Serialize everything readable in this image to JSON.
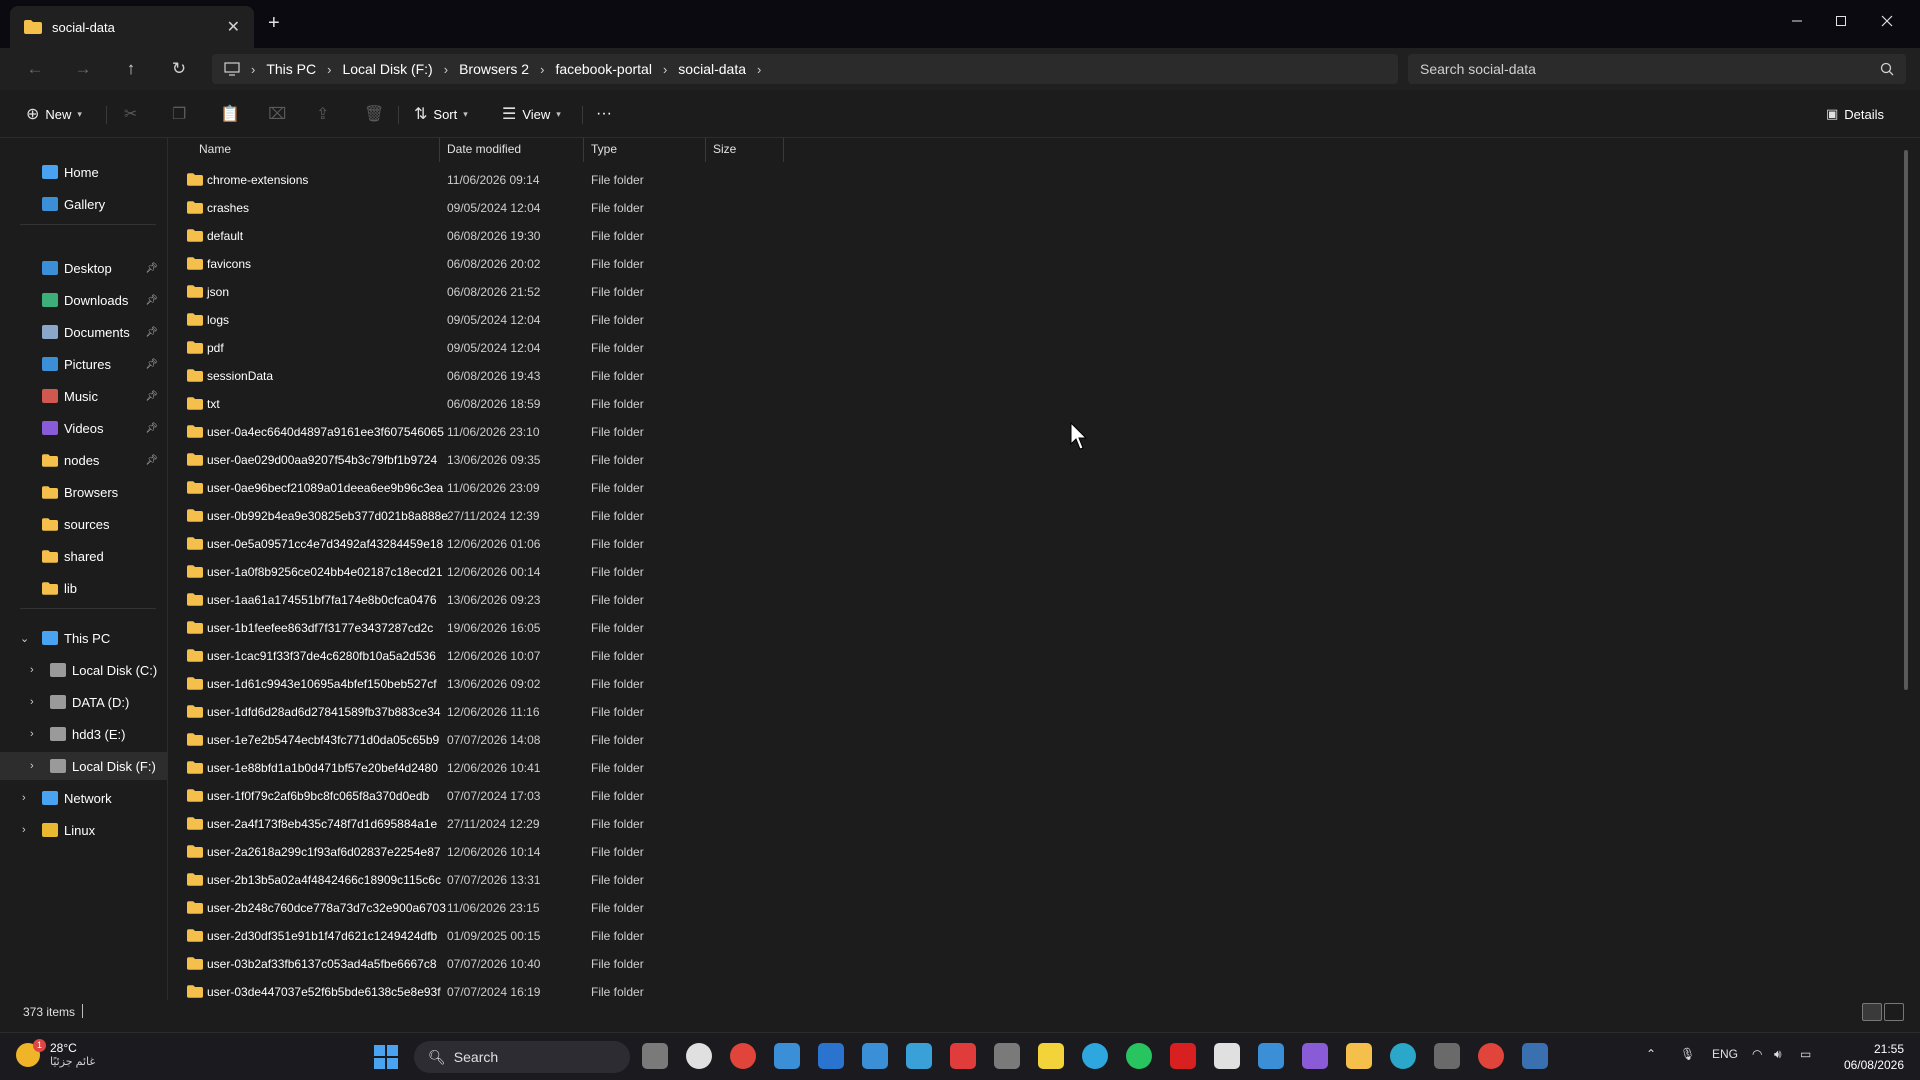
{
  "window": {
    "tab_title": "social-data",
    "new_tab": "+",
    "close_tab": "✕"
  },
  "address": {
    "breadcrumbs": [
      "This PC",
      "Local Disk (F:)",
      "Browsers 2",
      "facebook-portal",
      "social-data"
    ],
    "search_placeholder": "Search social-data"
  },
  "toolbar": {
    "new_label": "New",
    "sort_label": "Sort",
    "view_label": "View",
    "more_label": "···",
    "details_label": "Details"
  },
  "sidebar": {
    "top": [
      {
        "label": "Home",
        "icon": "home-icon"
      },
      {
        "label": "Gallery",
        "icon": "gallery-icon"
      }
    ],
    "quick": [
      {
        "label": "Desktop",
        "icon": "desktop-icon",
        "color": "#3a8fd6"
      },
      {
        "label": "Downloads",
        "icon": "download-icon",
        "color": "#3db07a"
      },
      {
        "label": "Documents",
        "icon": "document-icon",
        "color": "#8aa7c9"
      },
      {
        "label": "Pictures",
        "icon": "pictures-icon",
        "color": "#3a8fd6"
      },
      {
        "label": "Music",
        "icon": "music-icon",
        "color": "#d0584f"
      },
      {
        "label": "Videos",
        "icon": "videos-icon",
        "color": "#8a5bd6"
      },
      {
        "label": "nodes",
        "icon": "folder-icon",
        "color": "#f4c04b"
      }
    ],
    "folders": [
      {
        "label": "Browsers",
        "icon": "folder-icon"
      },
      {
        "label": "sources",
        "icon": "folder-icon"
      },
      {
        "label": "shared",
        "icon": "folder-icon"
      },
      {
        "label": "lib",
        "icon": "folder-icon"
      }
    ],
    "this_pc": "This PC",
    "drives": [
      "Local Disk (C:)",
      "DATA (D:)",
      "hdd3 (E:)",
      "Local Disk (F:)"
    ],
    "network": "Network",
    "linux": "Linux"
  },
  "columns": [
    "Name",
    "Date modified",
    "Type",
    "Size"
  ],
  "files": [
    {
      "name": "chrome-extensions",
      "date": "11/06/2026 09:14",
      "type": "File folder"
    },
    {
      "name": "crashes",
      "date": "09/05/2024 12:04",
      "type": "File folder"
    },
    {
      "name": "default",
      "date": "06/08/2026 19:30",
      "type": "File folder"
    },
    {
      "name": "favicons",
      "date": "06/08/2026 20:02",
      "type": "File folder"
    },
    {
      "name": "json",
      "date": "06/08/2026 21:52",
      "type": "File folder"
    },
    {
      "name": "logs",
      "date": "09/05/2024 12:04",
      "type": "File folder"
    },
    {
      "name": "pdf",
      "date": "09/05/2024 12:04",
      "type": "File folder"
    },
    {
      "name": "sessionData",
      "date": "06/08/2026 19:43",
      "type": "File folder"
    },
    {
      "name": "txt",
      "date": "06/08/2026 18:59",
      "type": "File folder"
    },
    {
      "name": "user-0a4ec6640d4897a9161ee3f607546065",
      "date": "11/06/2026 23:10",
      "type": "File folder"
    },
    {
      "name": "user-0ae029d00aa9207f54b3c79fbf1b9724",
      "date": "13/06/2026 09:35",
      "type": "File folder"
    },
    {
      "name": "user-0ae96becf21089a01deea6ee9b96c3ea",
      "date": "11/06/2026 23:09",
      "type": "File folder"
    },
    {
      "name": "user-0b992b4ea9e30825eb377d021b8a888e",
      "date": "27/11/2024 12:39",
      "type": "File folder"
    },
    {
      "name": "user-0e5a09571cc4e7d3492af43284459e18",
      "date": "12/06/2026 01:06",
      "type": "File folder"
    },
    {
      "name": "user-1a0f8b9256ce024bb4e02187c18ecd21",
      "date": "12/06/2026 00:14",
      "type": "File folder"
    },
    {
      "name": "user-1aa61a174551bf7fa174e8b0cfca0476",
      "date": "13/06/2026 09:23",
      "type": "File folder"
    },
    {
      "name": "user-1b1feefee863df7f3177e3437287cd2c",
      "date": "19/06/2026 16:05",
      "type": "File folder"
    },
    {
      "name": "user-1cac91f33f37de4c6280fb10a5a2d536",
      "date": "12/06/2026 10:07",
      "type": "File folder"
    },
    {
      "name": "user-1d61c9943e10695a4bfef150beb527cf",
      "date": "13/06/2026 09:02",
      "type": "File folder"
    },
    {
      "name": "user-1dfd6d28ad6d27841589fb37b883ce34",
      "date": "12/06/2026 11:16",
      "type": "File folder"
    },
    {
      "name": "user-1e7e2b5474ecbf43fc771d0da05c65b9",
      "date": "07/07/2026 14:08",
      "type": "File folder"
    },
    {
      "name": "user-1e88bfd1a1b0d471bf57e20bef4d2480",
      "date": "12/06/2026 10:41",
      "type": "File folder"
    },
    {
      "name": "user-1f0f79c2af6b9bc8fc065f8a370d0edb",
      "date": "07/07/2024 17:03",
      "type": "File folder"
    },
    {
      "name": "user-2a4f173f8eb435c748f7d1d695884a1e",
      "date": "27/11/2024 12:29",
      "type": "File folder"
    },
    {
      "name": "user-2a2618a299c1f93af6d02837e2254e87",
      "date": "12/06/2026 10:14",
      "type": "File folder"
    },
    {
      "name": "user-2b13b5a02a4f4842466c18909c115c6c",
      "date": "07/07/2026 13:31",
      "type": "File folder"
    },
    {
      "name": "user-2b248c760dce778a73d7c32e900a6703",
      "date": "11/06/2026 23:15",
      "type": "File folder"
    },
    {
      "name": "user-2d30df351e91b1f47d621c1249424dfb",
      "date": "01/09/2025 00:15",
      "type": "File folder"
    },
    {
      "name": "user-03b2af33fb6137c053ad4a5fbe6667c8",
      "date": "07/07/2026 10:40",
      "type": "File folder"
    },
    {
      "name": "user-03de447037e52f6b5bde6138c5e8e93f",
      "date": "07/07/2024 16:19",
      "type": "File folder"
    }
  ],
  "status": {
    "item_count": "373 items"
  },
  "taskbar": {
    "temp": "28°C",
    "location": "غائم جزئيًا",
    "weather_badge": "1",
    "search_label": "Search",
    "lang": "ENG",
    "time": "21:55",
    "date": "06/08/2026"
  },
  "colors": {
    "folder": "#f4c04b",
    "accent": "#4aa3f0"
  }
}
